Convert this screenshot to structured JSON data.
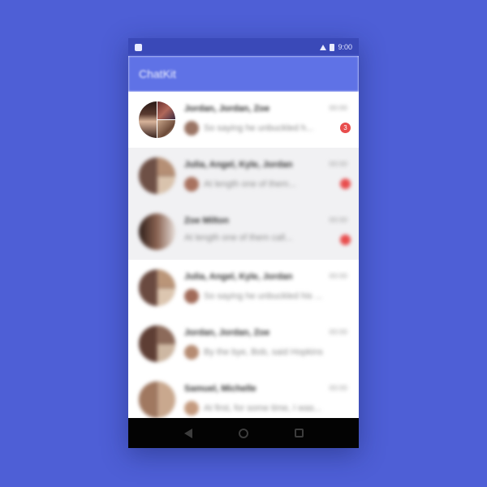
{
  "app": {
    "title": "ChatKit",
    "status_time": "9:00"
  },
  "colors": {
    "background": "#4e5fd6",
    "status_bar": "#3a49b8",
    "app_bar": "#5f72e6",
    "badge": "#e84d4d"
  },
  "dialogs": [
    {
      "name": "Jordan, Jordan, Zoe",
      "time": "00:00",
      "message": "So saying he unbuckled h...",
      "badge": "3",
      "avatar": "group-avatar",
      "mini_avatar": "sender-avatar"
    },
    {
      "name": "Julia, Angel, Kyle, Jordan",
      "time": "00:00",
      "message": "At length one of them...",
      "badge": "",
      "avatar": "group-avatar",
      "mini_avatar": "sender-avatar"
    },
    {
      "name": "Zoe Milton",
      "time": "00:00",
      "message": "At length one of them call...",
      "badge": "",
      "avatar": "user-avatar",
      "mini_avatar": ""
    },
    {
      "name": "Julia, Angel, Kyle, Jordan",
      "time": "00:00",
      "message": "So saying he unbuckled his ...",
      "badge": "",
      "avatar": "group-avatar",
      "mini_avatar": "sender-avatar"
    },
    {
      "name": "Jordan, Jordan, Zoe",
      "time": "00:00",
      "message": "By the bye, Bob, said Hopkins",
      "badge": "",
      "avatar": "group-avatar",
      "mini_avatar": "sender-avatar"
    },
    {
      "name": "Samuel, Michelle",
      "time": "00:00",
      "message": "At first, for some time, I was...",
      "badge": "",
      "avatar": "group-avatar",
      "mini_avatar": "sender-avatar"
    }
  ],
  "navbar": {
    "back_icon": "back-icon",
    "home_icon": "home-icon",
    "recents_icon": "recents-icon"
  }
}
